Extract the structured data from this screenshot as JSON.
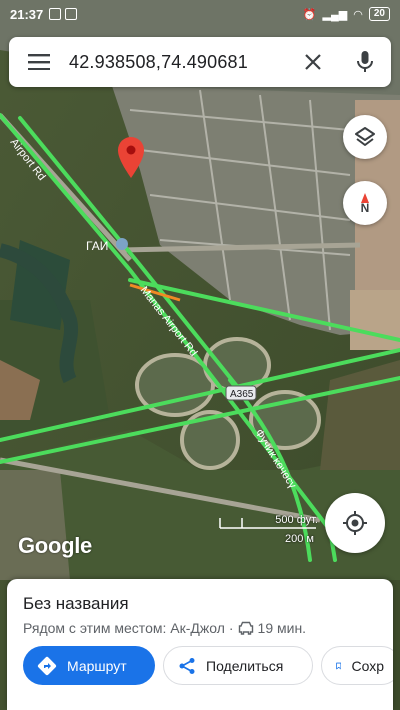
{
  "status_bar": {
    "time": "21:37",
    "battery": "20"
  },
  "search": {
    "query": "42.938508,74.490681"
  },
  "map": {
    "labels": {
      "airport_rd": "Airport Rd",
      "gai": "ГАИ",
      "manas_airport_rd": "Manas Airport Rd",
      "a365": "A365",
      "fuchik": "Фучик көчөсү"
    },
    "logo": "Google",
    "scale": {
      "feet": "500 фут.",
      "meters": "200 м"
    },
    "compass": "N"
  },
  "place": {
    "title": "Без названия",
    "nearby": "Рядом с этим местом: Ак-Джол",
    "separator": "·",
    "drive_time": "19 мин."
  },
  "actions": {
    "route": "Маршрут",
    "share": "Поделиться",
    "save": "Сохр"
  },
  "colors": {
    "accent": "#1a73e8",
    "pin": "#ea4335",
    "traffic": "#4cdc5c"
  }
}
